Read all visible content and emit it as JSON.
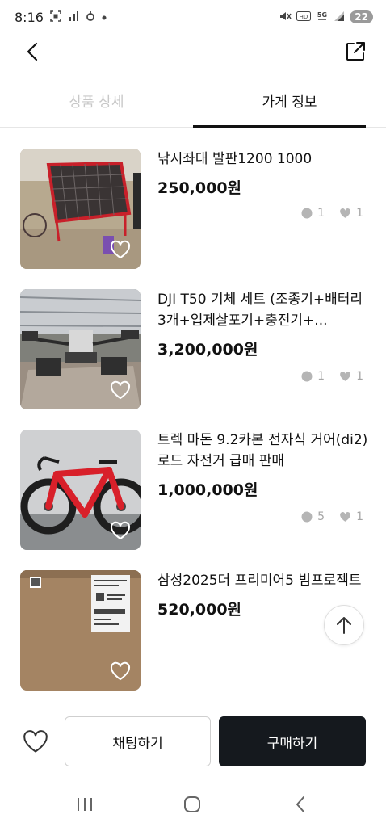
{
  "status_bar": {
    "time": "8:16",
    "left_icons": [
      "scan-icon",
      "signal-bars-icon",
      "sync-icon",
      "dot-icon"
    ],
    "right_icons": [
      "mute-icon",
      "hd-icon",
      "5g-icon",
      "signal-icon"
    ],
    "battery": "22"
  },
  "tabs": [
    {
      "label": "상품 상세",
      "active": false
    },
    {
      "label": "가게 정보",
      "active": true
    }
  ],
  "products": [
    {
      "title": "낚시좌대 발판1200 1000",
      "price": "250,000원",
      "chats": "1",
      "likes": "1"
    },
    {
      "title": "DJI T50 기체 세트 (조종기+배터리3개+입제살포기+충전기+...",
      "price": "3,200,000원",
      "chats": "1",
      "likes": "1"
    },
    {
      "title": "트렉 마돈 9.2카본 전자식 거어(di2) 로드 자전거 급매 판매",
      "price": "1,000,000원",
      "chats": "5",
      "likes": "1"
    },
    {
      "title": "삼성2025더 프리미어5 빔프로젝트",
      "price": "520,000원",
      "chats": "",
      "likes": ""
    }
  ],
  "bottom_bar": {
    "chat_label": "채팅하기",
    "buy_label": "구매하기"
  },
  "colors": {
    "buy_button": "#15191e",
    "inactive_tab": "#c8c8c8",
    "stats": "#a6a6a6"
  }
}
